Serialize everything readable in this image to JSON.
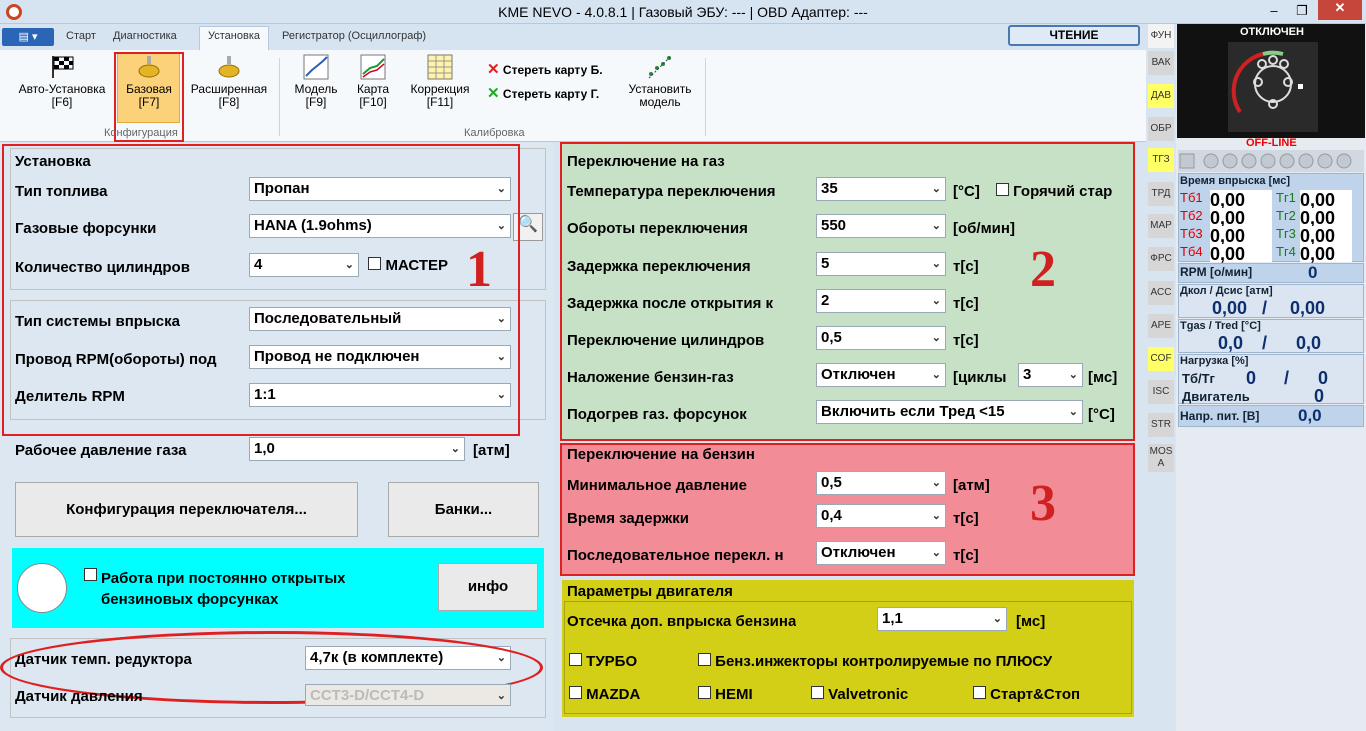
{
  "window": {
    "title": "KME NEVO - 4.0.8.1  |  Газовый ЭБУ: ---  |  OBD Адаптер: ---"
  },
  "ribbon_tabs": [
    "Старт",
    "Диагностика",
    "Установка",
    "Регистратор (Осциллограф)"
  ],
  "read_button": "ЧТЕНИЕ",
  "ribbon": {
    "auto_setup": "Авто-Установка",
    "auto_setup_key": "[F6]",
    "basic": "Базовая",
    "basic_key": "[F7]",
    "extended": "Расширенная",
    "extended_key": "[F8]",
    "config_group": "Конфигурация",
    "model": "Модель",
    "model_key": "[F9]",
    "map": "Карта",
    "map_key": "[F10]",
    "correction": "Коррекция",
    "correction_key": "[F11]",
    "erase_b": "Стереть карту Б.",
    "erase_g": "Стереть карту Г.",
    "set_model_1": "Установить",
    "set_model_2": "модель",
    "calib_group": "Калибровка"
  },
  "setup": {
    "title": "Установка",
    "fuel_type_label": "Тип топлива",
    "fuel_type": "Пропан",
    "injectors_label": "Газовые форсунки",
    "injectors": "HANA (1.9ohms)",
    "cylinders_label": "Количество цилиндров",
    "cylinders": "4",
    "master_label": "МАСТЕР",
    "injection_label": "Тип системы впрыска",
    "injection": "Последовательный",
    "rpm_wire_label": "Провод RPM(обороты) под",
    "rpm_wire": "Провод не подключен",
    "rpm_div_label": "Делитель RPM",
    "rpm_div": "1:1",
    "pressure_label": "Рабочее давление газа",
    "pressure": "1,0",
    "pressure_unit": "[атм]",
    "switch_config_btn": "Конфигурация переключателя...",
    "banks_btn": "Банки...",
    "open_injectors_label_1": "Работа при постоянно открытых",
    "open_injectors_label_2": "бензиновых форсунках",
    "info_btn": "инфо",
    "reducer_temp_label": "Датчик темп. редуктора",
    "reducer_temp": "4,7к (в комплекте)",
    "pressure_sensor_label": "Датчик давления",
    "pressure_sensor": "CCT3-D/CCT4-D"
  },
  "annotations": [
    "1",
    "2",
    "3"
  ],
  "gas_switch": {
    "title": "Переключение на газ",
    "temp_label": "Температура переключения",
    "temp": "35",
    "temp_unit": "[°C]",
    "hot_start_label": "Горячий стар",
    "rpm_label": "Обороты переключения",
    "rpm": "550",
    "rpm_unit": "[об/мин]",
    "delay_label": "Задержка переключения",
    "delay": "5",
    "delay_unit": "т[с]",
    "delay_open_label": "Задержка после открытия к",
    "delay_open": "2",
    "delay_open_unit": "т[с]",
    "cyl_switch_label": "Переключение цилиндров",
    "cyl_switch": "0,5",
    "cyl_switch_unit": "т[с]",
    "overlap_label": "Наложение бензин-газ",
    "overlap": "Отключен",
    "overlap_cycles": "[циклы",
    "overlap_val": "3",
    "overlap_unit": "[мс]",
    "heat_label": "Подогрев газ. форсунок",
    "heat": "Включить если Тред <15",
    "heat_unit": "[°C]"
  },
  "petrol_switch": {
    "title": "Переключение на бензин",
    "min_press_label": "Минимальное давление",
    "min_press": "0,5",
    "min_press_unit": "[атм]",
    "delay_label": "Время задержки",
    "delay": "0,4",
    "delay_unit": "т[с]",
    "seq_label": "Последовательное перекл. н",
    "seq": "Отключен",
    "seq_unit": "т[с]"
  },
  "engine": {
    "title": "Параметры двигателя",
    "cutoff_label": "Отсечка доп. впрыска бензина",
    "cutoff": "1,1",
    "cutoff_unit": "[мс]",
    "turbo": "ТУРБО",
    "plus_inj": "Бенз.инжекторы контролируемые по ПЛЮСУ",
    "mazda": "MAZDA",
    "hemi": "HEMI",
    "valvetronic": "Valvetronic",
    "startstop": "Старт&Стоп"
  },
  "side_tabs": [
    "ФУН",
    "ВАК",
    "ДАВ",
    "ОБР",
    "ТГЗ",
    "ТРД",
    "МАР",
    "ФРС",
    "АСС",
    "АРЕ",
    "COF",
    "ISC",
    "STR",
    "MOS A"
  ],
  "status": {
    "state": "ОТКЛЮЧЕН",
    "offline": "OFF-LINE",
    "inj_time_hdr": "Время впрыска [мс]",
    "tb": [
      {
        "l": "Тб1",
        "v": "0,00"
      },
      {
        "l": "Тб2",
        "v": "0,00"
      },
      {
        "l": "Тб3",
        "v": "0,00"
      },
      {
        "l": "Тб4",
        "v": "0,00"
      }
    ],
    "tg": [
      {
        "l": "Тг1",
        "v": "0,00"
      },
      {
        "l": "Тг2",
        "v": "0,00"
      },
      {
        "l": "Тг3",
        "v": "0,00"
      },
      {
        "l": "Тг4",
        "v": "0,00"
      }
    ],
    "rpm_lbl": "RPM [о/мин]",
    "rpm": "0",
    "press_hdr": "Дкол / Дсис [атм]",
    "press_a": "0,00",
    "press_b": "0,00",
    "slash": "/",
    "temp_hdr": "Tgas / Tred [°C]",
    "temp_a": "0,0",
    "temp_b": "0,0",
    "load_hdr": "Нагрузка [%]",
    "load_lbl": "Тб/Тг",
    "load_a": "0",
    "load_b": "0",
    "engine_lbl": "Двигатель",
    "engine_val": "0",
    "volt_lbl": "Напр. пит. [В]",
    "volt": "0,0"
  }
}
